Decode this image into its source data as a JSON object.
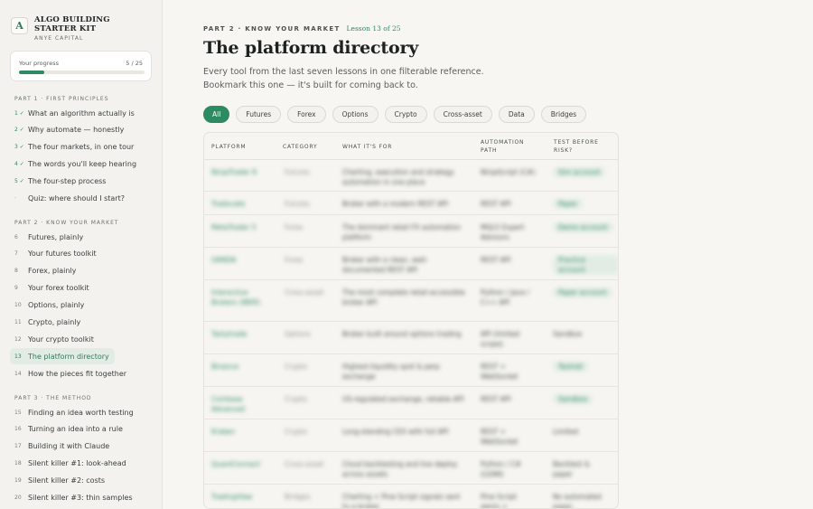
{
  "sidebar": {
    "brand": {
      "logo": "A",
      "title": "ALGO BUILDING STARTER KIT",
      "subtitle": "ANYE CAPITAL"
    },
    "progress": {
      "label": "Your progress",
      "count": "5 / 25",
      "fraction": 0.2
    },
    "parts": [
      {
        "heading": "PART 1 · FIRST PRINCIPLES",
        "items": [
          {
            "num": "1 ✓",
            "label": "What an algorithm actually is"
          },
          {
            "num": "2 ✓",
            "label": "Why automate — honestly"
          },
          {
            "num": "3 ✓",
            "label": "The four markets, in one tour"
          },
          {
            "num": "4 ✓",
            "label": "The words you'll keep hearing"
          },
          {
            "num": "5 ✓",
            "label": "The four-step process"
          },
          {
            "num": "·",
            "label": "Quiz: where should I start?"
          }
        ]
      },
      {
        "heading": "PART 2 · KNOW YOUR MARKET",
        "items": [
          {
            "num": "6",
            "label": "Futures, plainly"
          },
          {
            "num": "7",
            "label": "Your futures toolkit"
          },
          {
            "num": "8",
            "label": "Forex, plainly"
          },
          {
            "num": "9",
            "label": "Your forex toolkit"
          },
          {
            "num": "10",
            "label": "Options, plainly"
          },
          {
            "num": "11",
            "label": "Crypto, plainly"
          },
          {
            "num": "12",
            "label": "Your crypto toolkit"
          },
          {
            "num": "13",
            "label": "The platform directory"
          },
          {
            "num": "14",
            "label": "How the pieces fit together"
          }
        ]
      },
      {
        "heading": "PART 3 · THE METHOD",
        "items": [
          {
            "num": "15",
            "label": "Finding an idea worth testing"
          },
          {
            "num": "16",
            "label": "Turning an idea into a rule"
          },
          {
            "num": "17",
            "label": "Building it with Claude"
          },
          {
            "num": "18",
            "label": "Silent killer #1: look-ahead"
          },
          {
            "num": "19",
            "label": "Silent killer #2: costs"
          },
          {
            "num": "20",
            "label": "Silent killer #3: thin samples"
          }
        ]
      }
    ]
  },
  "main": {
    "crumb_part": "PART 2 · KNOW YOUR MARKET",
    "crumb_lesson": "Lesson 13 of 25",
    "title": "The platform directory",
    "intro_line1": "Every tool from the last seven lessons in one filterable reference.",
    "intro_line2": "Bookmark this one — it's built for coming back to.",
    "filters": [
      "All",
      "Futures",
      "Forex",
      "Options",
      "Crypto",
      "Cross-asset",
      "Data",
      "Bridges"
    ],
    "table": {
      "headers": {
        "platform": "PLATFORM",
        "category": "CATEGORY",
        "what": "WHAT IT'S FOR",
        "auto_l1": "AUTOMATION",
        "auto_l2": "PATH",
        "test_l1": "TEST BEFORE",
        "test_l2": "RISK?"
      },
      "rows": [
        {
          "platform": "NinjaTrader 8",
          "category": "Futures",
          "what": "Charting, execution and strategy automation in one place",
          "auto": "NinjaScript (C#)",
          "test": "Sim account"
        },
        {
          "platform": "Tradovate",
          "category": "Futures",
          "what": "Broker with a modern REST API",
          "auto": "REST API",
          "test": "Paper"
        },
        {
          "platform": "MetaTrader 5",
          "category": "Forex",
          "what": "The dominant retail FX automation platform",
          "auto": "MQL5 Expert Advisors",
          "test": "Demo account"
        },
        {
          "platform": "OANDA",
          "category": "Forex",
          "what": "Broker with a clean, well-documented REST API",
          "auto": "REST API",
          "test": "Practice account"
        },
        {
          "platform": "Interactive Brokers (IBKR)",
          "category": "Cross-asset",
          "what": "The most complete retail-accessible broker API",
          "auto": "Python / Java / C++ API",
          "test": "Paper account"
        },
        {
          "platform": "Tastytrade",
          "category": "Options",
          "what": "Broker built around options trading",
          "auto": "API (limited scope)",
          "test": "Sandbox"
        },
        {
          "platform": "Binance",
          "category": "Crypto",
          "what": "Highest-liquidity spot & perp exchange",
          "auto": "REST + WebSocket",
          "test": "Testnet"
        },
        {
          "platform": "Coinbase Advanced",
          "category": "Crypto",
          "what": "US-regulated exchange, reliable API",
          "auto": "REST API",
          "test": "Sandbox"
        },
        {
          "platform": "Kraken",
          "category": "Crypto",
          "what": "Long-standing CEX with full API",
          "auto": "REST + WebSocket",
          "test": "Limited"
        },
        {
          "platform": "QuantConnect",
          "category": "Cross-asset",
          "what": "Cloud backtesting and live deploy across assets",
          "auto": "Python / C# (LEAN)",
          "test": "Backtest & paper"
        },
        {
          "platform": "TradingView",
          "category": "Bridges",
          "what": "Charting + Pine Script signals sent to a broker",
          "auto": "Pine Script alerts + webhook",
          "test": "No automated paper"
        }
      ]
    }
  }
}
